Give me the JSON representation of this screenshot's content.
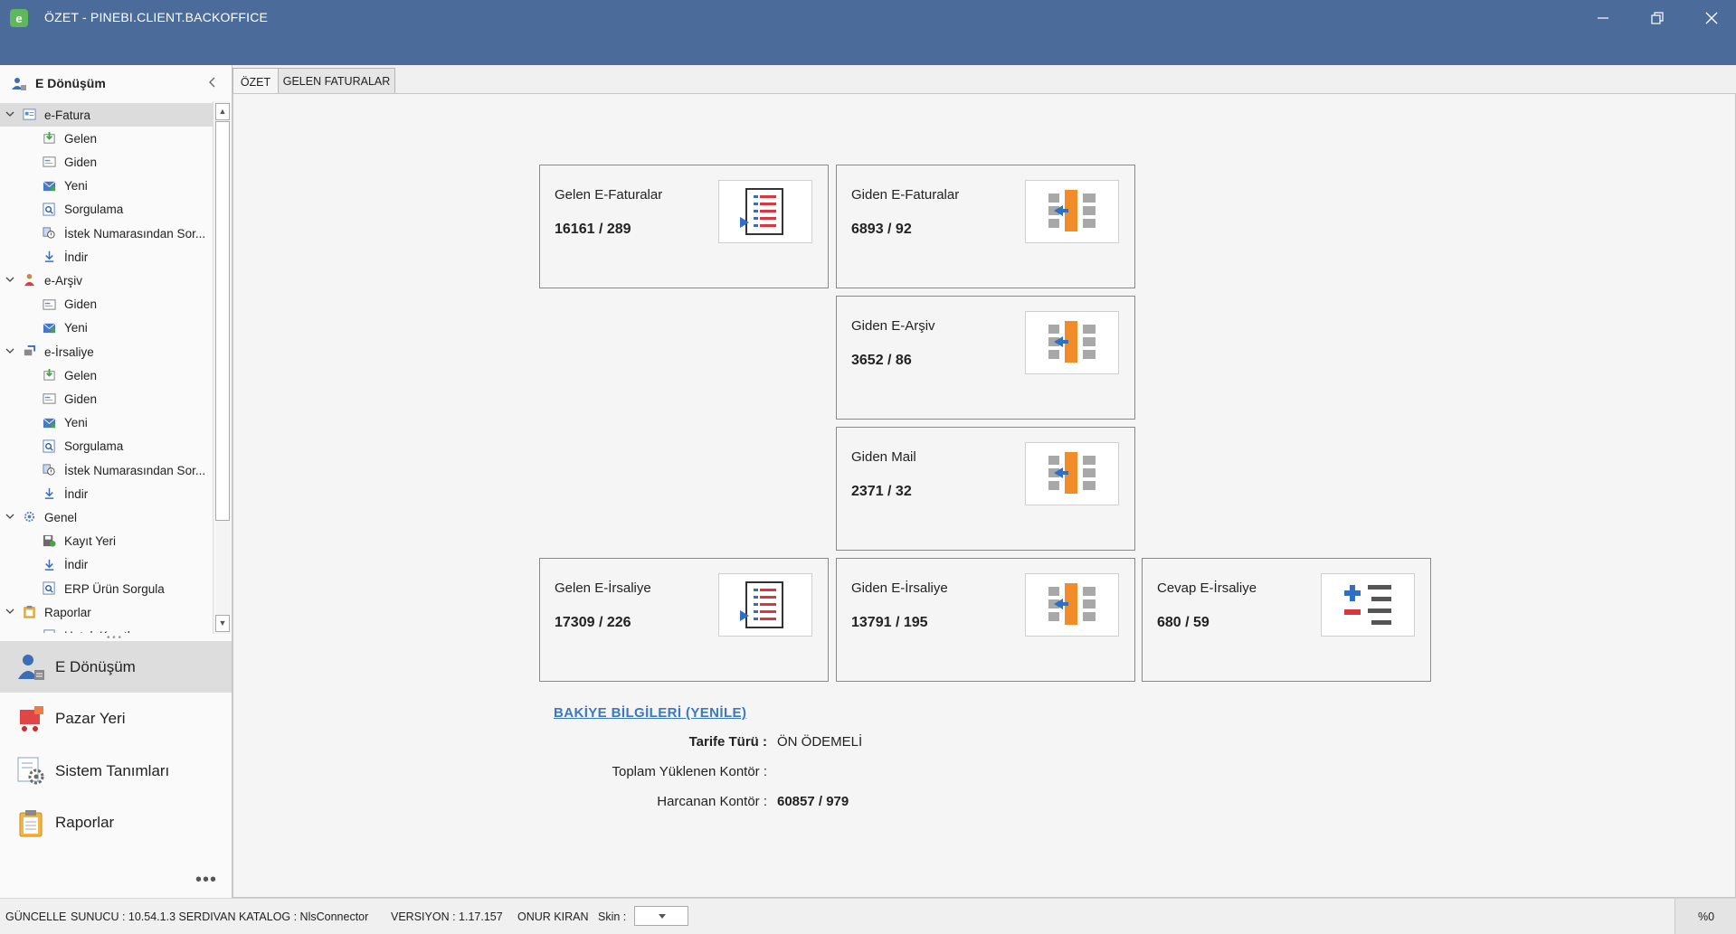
{
  "window": {
    "title": "ÖZET - PINEBI.CLIENT.BACKOFFICE",
    "minimize_icon": "minimize-icon",
    "restore_icon": "restore-icon",
    "close_icon": "close-icon"
  },
  "nav": {
    "header_title": "E Dönüşüm",
    "tree": [
      {
        "label": "e-Fatura",
        "level": 0,
        "expanded": true,
        "selected": true,
        "icon": "invoice-icon"
      },
      {
        "label": "Gelen",
        "level": 1,
        "icon": "incoming-icon"
      },
      {
        "label": "Giden",
        "level": 1,
        "icon": "outgoing-icon"
      },
      {
        "label": "Yeni",
        "level": 1,
        "icon": "new-mail-icon"
      },
      {
        "label": "Sorgulama",
        "level": 1,
        "icon": "query-icon"
      },
      {
        "label": "İstek Numarasından Sor...",
        "level": 1,
        "icon": "request-query-icon"
      },
      {
        "label": "İndir",
        "level": 1,
        "icon": "download-icon"
      },
      {
        "label": "e-Arşiv",
        "level": 0,
        "expanded": true,
        "icon": "archive-user-icon"
      },
      {
        "label": "Giden",
        "level": 1,
        "icon": "outgoing-icon"
      },
      {
        "label": "Yeni",
        "level": 1,
        "icon": "new-mail-icon"
      },
      {
        "label": "e-İrsaliye",
        "level": 0,
        "expanded": true,
        "icon": "dispatch-icon"
      },
      {
        "label": "Gelen",
        "level": 1,
        "icon": "incoming-icon"
      },
      {
        "label": "Giden",
        "level": 1,
        "icon": "outgoing-icon"
      },
      {
        "label": "Yeni",
        "level": 1,
        "icon": "new-mail-icon"
      },
      {
        "label": "Sorgulama",
        "level": 1,
        "icon": "query-icon"
      },
      {
        "label": "İstek Numarasından Sor...",
        "level": 1,
        "icon": "request-query-icon"
      },
      {
        "label": "İndir",
        "level": 1,
        "icon": "download-icon"
      },
      {
        "label": "Genel",
        "level": 0,
        "expanded": true,
        "icon": "gear-icon"
      },
      {
        "label": "Kayıt Yeri",
        "level": 1,
        "icon": "save-location-icon"
      },
      {
        "label": "İndir",
        "level": 1,
        "icon": "download-icon"
      },
      {
        "label": "ERP Ürün Sorgula",
        "level": 1,
        "icon": "query-icon"
      },
      {
        "label": "Raporlar",
        "level": 0,
        "expanded": true,
        "icon": "clipboard-icon"
      },
      {
        "label": "Hatalı Kayıtlar",
        "level": 1,
        "icon": "report-icon"
      }
    ],
    "groups": [
      {
        "label": "E Dönüşüm",
        "selected": true,
        "icon": "user-document-icon"
      },
      {
        "label": "Pazar Yeri",
        "icon": "shopping-cart-icon"
      },
      {
        "label": "Sistem Tanımları",
        "icon": "settings-icon"
      },
      {
        "label": "Raporlar",
        "icon": "clipboard-icon"
      }
    ],
    "more_label": "•••"
  },
  "tabs": [
    {
      "label": "ÖZET",
      "active": true
    },
    {
      "label": "GELEN FATURALAR",
      "active": false
    }
  ],
  "cards": [
    {
      "title": "Gelen E-Faturalar",
      "value": "16161 / 289",
      "icon": "incoming-document-icon"
    },
    {
      "title": "Giden E-Faturalar",
      "value": "6893 / 92",
      "icon": "outgoing-document-icon"
    },
    {
      "title": "Giden E-Arşiv",
      "value": "3652 / 86",
      "icon": "outgoing-document-icon"
    },
    {
      "title": "Giden Mail",
      "value": "2371 / 32",
      "icon": "outgoing-document-icon"
    },
    {
      "title": "Gelen E-İrsaliye",
      "value": "17309 / 226",
      "icon": "incoming-document-icon"
    },
    {
      "title": "Giden E-İrsaliye",
      "value": "13791 / 195",
      "icon": "outgoing-document-icon"
    },
    {
      "title": "Cevap E-İrsaliye",
      "value": "680 / 59",
      "icon": "plus-minus-list-icon"
    }
  ],
  "balance": {
    "link": "BAKİYE BİLGİLERİ (YENİLE)",
    "rows": [
      {
        "label": "Tarife Türü :",
        "value": "ÖN ÖDEMELİ",
        "bold_label": true,
        "bold_value": false
      },
      {
        "label": "Toplam Yüklenen Kontör :",
        "value": "",
        "bold_label": false,
        "bold_value": false
      },
      {
        "label": "Harcanan Kontör :",
        "value": "60857 / 979",
        "bold_label": false,
        "bold_value": true
      }
    ]
  },
  "status": {
    "update": "GÜNCELLE",
    "server": "SUNUCU : 10.54.1.3 SERDIVAN KATALOG : NlsConnector",
    "version": "VERSIYON : 1.17.157",
    "user": "ONUR KIRAN",
    "skin_label": "Skin :",
    "skin_value": "",
    "percent": "%0"
  },
  "colors": {
    "titlebar": "#4b6c9b",
    "link": "#3a78c7",
    "orange": "#f28c28",
    "blue": "#2f6fc4",
    "red": "#d9363e"
  }
}
